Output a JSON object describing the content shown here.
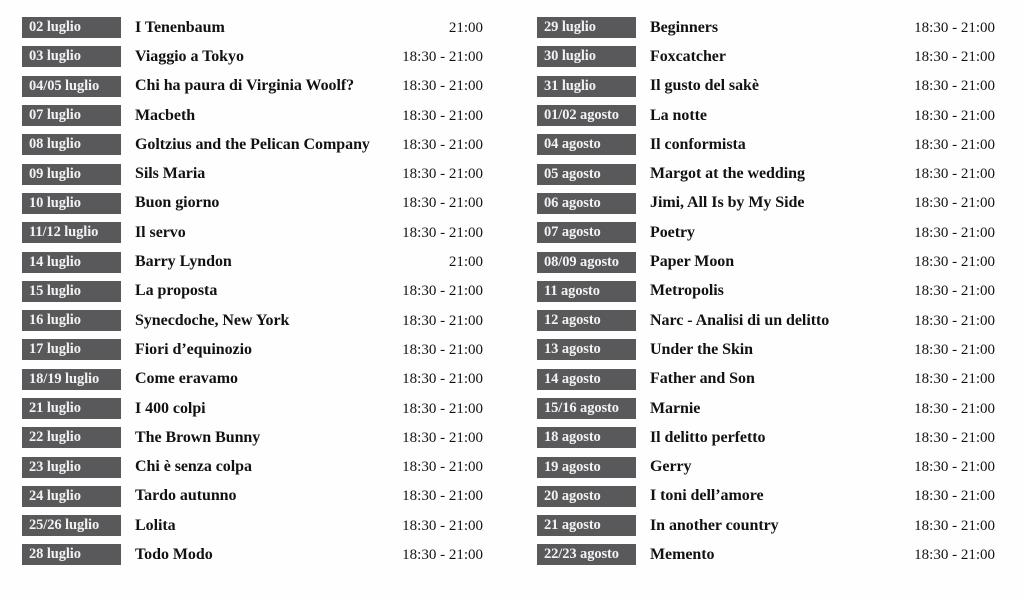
{
  "columns": [
    {
      "name": "left-column",
      "rows": [
        {
          "date": "02 luglio",
          "title": "I Tenenbaum",
          "time": "21:00"
        },
        {
          "date": "03 luglio",
          "title": "Viaggio a Tokyo",
          "time": "18:30 - 21:00"
        },
        {
          "date": "04/05 luglio",
          "title": "Chi ha paura di Virginia Woolf?",
          "time": "18:30 - 21:00"
        },
        {
          "date": "07 luglio",
          "title": "Macbeth",
          "time": "18:30 - 21:00"
        },
        {
          "date": "08 luglio",
          "title": "Goltzius and the Pelican Company",
          "time": "18:30 - 21:00"
        },
        {
          "date": "09 luglio",
          "title": "Sils Maria",
          "time": "18:30 - 21:00"
        },
        {
          "date": "10 luglio",
          "title": "Buon giorno",
          "time": "18:30 - 21:00"
        },
        {
          "date": "11/12 luglio",
          "title": "Il servo",
          "time": "18:30 - 21:00"
        },
        {
          "date": "14 luglio",
          "title": "Barry Lyndon",
          "time": "21:00"
        },
        {
          "date": "15 luglio",
          "title": "La proposta",
          "time": "18:30 - 21:00"
        },
        {
          "date": "16 luglio",
          "title": "Synecdoche, New York",
          "time": "18:30 - 21:00"
        },
        {
          "date": "17 luglio",
          "title": "Fiori d’equinozio",
          "time": "18:30 - 21:00"
        },
        {
          "date": "18/19 luglio",
          "title": "Come eravamo",
          "time": "18:30 - 21:00"
        },
        {
          "date": "21 luglio",
          "title": "I 400 colpi",
          "time": "18:30 - 21:00"
        },
        {
          "date": "22 luglio",
          "title": "The Brown Bunny",
          "time": "18:30 - 21:00"
        },
        {
          "date": "23 luglio",
          "title": "Chi è senza colpa",
          "time": "18:30 - 21:00"
        },
        {
          "date": "24 luglio",
          "title": "Tardo autunno",
          "time": "18:30 - 21:00"
        },
        {
          "date": "25/26 luglio",
          "title": "Lolita",
          "time": "18:30 - 21:00"
        },
        {
          "date": "28 luglio",
          "title": "Todo Modo",
          "time": "18:30 - 21:00"
        }
      ]
    },
    {
      "name": "right-column",
      "rows": [
        {
          "date": "29 luglio",
          "title": "Beginners",
          "time": "18:30 - 21:00"
        },
        {
          "date": "30 luglio",
          "title": "Foxcatcher",
          "time": "18:30 - 21:00"
        },
        {
          "date": "31 luglio",
          "title": "Il gusto del sakè",
          "time": "18:30 - 21:00"
        },
        {
          "date": "01/02 agosto",
          "title": "La notte",
          "time": "18:30 - 21:00"
        },
        {
          "date": "04 agosto",
          "title": "Il conformista",
          "time": "18:30 - 21:00"
        },
        {
          "date": "05 agosto",
          "title": "Margot at the wedding",
          "time": "18:30 - 21:00"
        },
        {
          "date": "06 agosto",
          "title": "Jimi, All Is by My Side",
          "time": "18:30 - 21:00"
        },
        {
          "date": "07 agosto",
          "title": "Poetry",
          "time": "18:30 - 21:00"
        },
        {
          "date": "08/09 agosto",
          "title": "Paper Moon",
          "time": "18:30 - 21:00"
        },
        {
          "date": "11 agosto",
          "title": "Metropolis",
          "time": "18:30 - 21:00"
        },
        {
          "date": "12 agosto",
          "title": "Narc - Analisi di un delitto",
          "time": "18:30 - 21:00"
        },
        {
          "date": "13 agosto",
          "title": "Under the Skin",
          "time": "18:30 - 21:00"
        },
        {
          "date": "14 agosto",
          "title": "Father and Son",
          "time": "18:30 - 21:00"
        },
        {
          "date": "15/16 agosto",
          "title": "Marnie",
          "time": "18:30 - 21:00"
        },
        {
          "date": "18 agosto",
          "title": "Il delitto perfetto",
          "time": "18:30 - 21:00"
        },
        {
          "date": "19 agosto",
          "title": "Gerry",
          "time": "18:30 - 21:00"
        },
        {
          "date": "20 agosto",
          "title": "I toni dell’amore",
          "time": "18:30 - 21:00"
        },
        {
          "date": "21 agosto",
          "title": "In another country",
          "time": "18:30 - 21:00"
        },
        {
          "date": "22/23 agosto",
          "title": "Memento",
          "time": "18:30 - 21:00"
        }
      ]
    }
  ],
  "colors": {
    "badge_background": "#59595b",
    "badge_text": "#f2f2f2",
    "body_text": "#121212",
    "page_background": "#fefefe"
  }
}
